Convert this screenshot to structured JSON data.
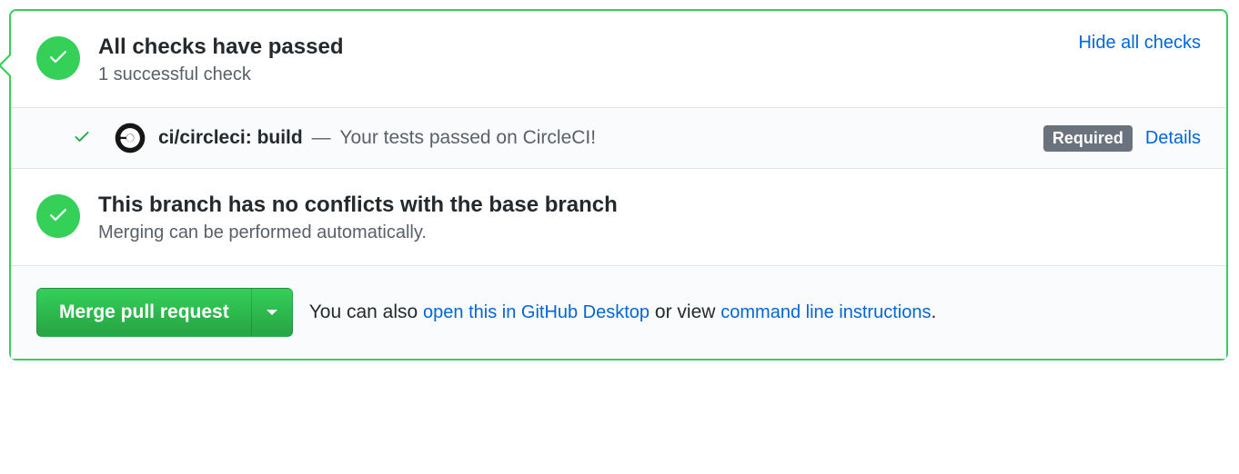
{
  "checks": {
    "title": "All checks have passed",
    "subtitle": "1 successful check",
    "toggle_link": "Hide all checks",
    "items": [
      {
        "icon": "circleci",
        "name": "ci/circleci: build",
        "separator": " — ",
        "description": "Your tests passed on CircleCI!",
        "required_badge": "Required",
        "details_link": "Details"
      }
    ]
  },
  "conflicts": {
    "title": "This branch has no conflicts with the base branch",
    "subtitle": "Merging can be performed automatically."
  },
  "merge": {
    "button_label": "Merge pull request",
    "hint_prefix": "You can also ",
    "desktop_link": "open this in GitHub Desktop",
    "hint_middle": " or view ",
    "cli_link": "command line instructions",
    "hint_suffix": "."
  }
}
